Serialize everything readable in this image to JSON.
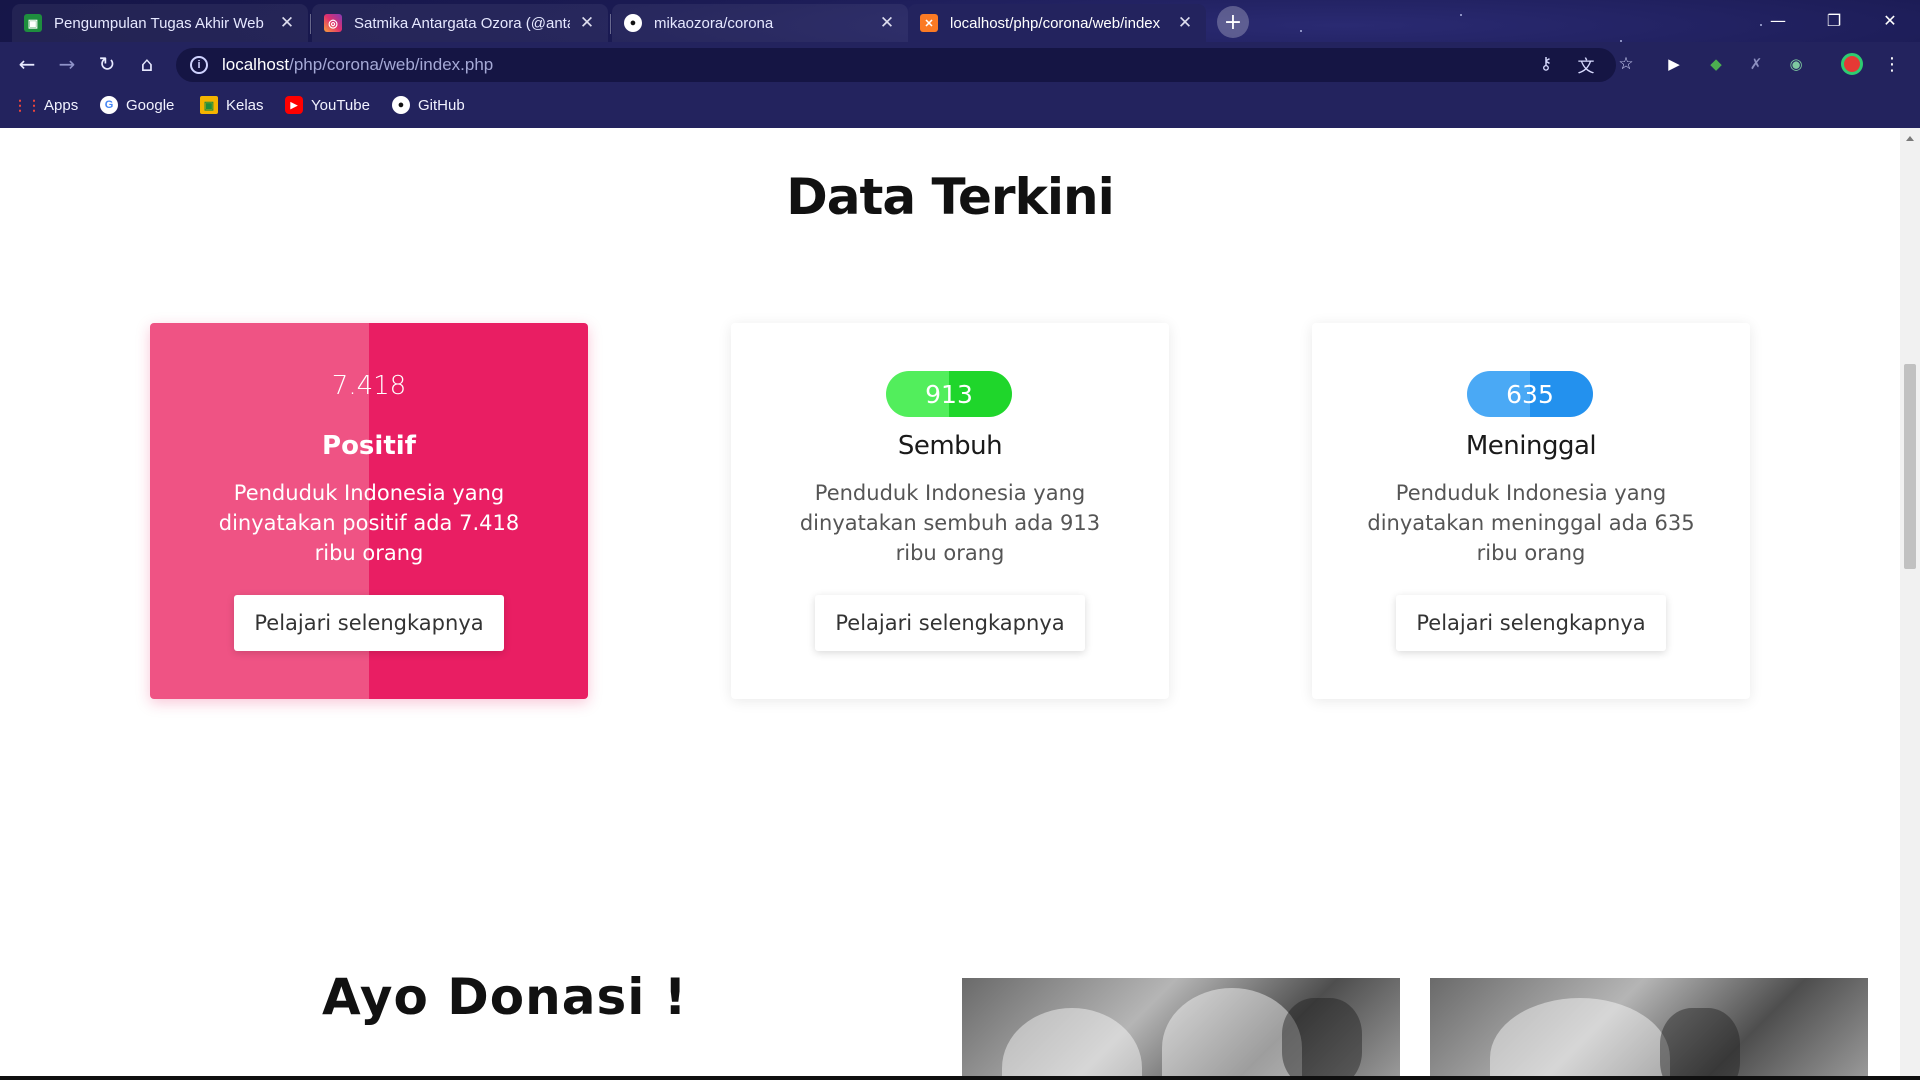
{
  "browser": {
    "tabs": [
      {
        "title": "Pengumpulan Tugas Akhir Web",
        "icon": "classroom-icon",
        "active": false
      },
      {
        "title": "Satmika Antargata Ozora (@anta",
        "icon": "instagram-icon",
        "active": false
      },
      {
        "title": "mikaozora/corona",
        "icon": "github-icon",
        "active": false
      },
      {
        "title": "localhost/php/corona/web/index",
        "icon": "xampp-icon",
        "active": true
      }
    ],
    "address": {
      "host": "localhost",
      "path": "/php/corona/web/index.php"
    },
    "bookmarks": [
      {
        "label": "Apps",
        "icon": "apps-grid-icon"
      },
      {
        "label": "Google",
        "icon": "google-icon"
      },
      {
        "label": "Kelas",
        "icon": "classroom-icon"
      },
      {
        "label": "YouTube",
        "icon": "youtube-icon"
      },
      {
        "label": "GitHub",
        "icon": "github-icon"
      }
    ]
  },
  "page": {
    "title": "Data Terkini",
    "cards": [
      {
        "value": "7.418",
        "label": "Positif",
        "description": "Penduduk Indonesia yang dinyatakan positif ada 7.418 ribu orang",
        "button": "Pelajari selengkapnya",
        "color": "#e91e63"
      },
      {
        "value": "913",
        "label": "Sembuh",
        "description": "Penduduk Indonesia yang dinyatakan sembuh ada 913 ribu orang",
        "button": "Pelajari selengkapnya",
        "color": "#1fd62b"
      },
      {
        "value": "635",
        "label": "Meninggal",
        "description": "Penduduk Indonesia yang dinyatakan meninggal ada 635 ribu orang",
        "button": "Pelajari selengkapnya",
        "color": "#2391ee"
      }
    ],
    "donation_title": "Ayo Donasi !"
  }
}
